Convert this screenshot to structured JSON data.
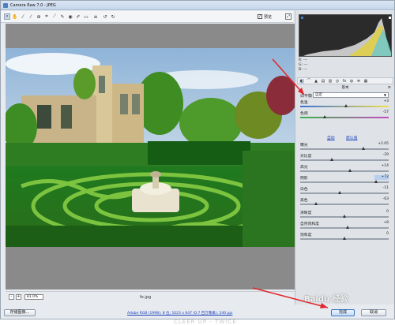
{
  "window": {
    "title": "Camera Raw 7.0 - JPEG"
  },
  "toolbar": {
    "tools": [
      "zoom-icon",
      "hand-icon",
      "white-balance-icon",
      "color-sampler-icon",
      "target-adjust-icon",
      "crop-icon",
      "straighten-icon",
      "spot-removal-icon",
      "red-eye-icon",
      "adjustment-brush-icon",
      "graduated-filter-icon",
      "preferences-icon",
      "rotate-ccw-icon",
      "rotate-cw-icon"
    ],
    "preview_label": "预览",
    "preview_checked": true
  },
  "histogram": {
    "r_label": "R:",
    "g_label": "G:",
    "b_label": "B:",
    "r_value": "---",
    "g_value": "---",
    "b_value": "---"
  },
  "panel": {
    "section_title": "基本",
    "wb_label": "白平衡",
    "wb_value": "自定",
    "auto_link": "自动",
    "default_link": "默认值",
    "sliders": [
      {
        "label": "色温",
        "value": "+3",
        "position": 0.52,
        "highlight": false
      },
      {
        "label": "色调",
        "value": "-57",
        "position": 0.28,
        "highlight": false
      },
      {
        "label": "曝光",
        "value": "+2.05",
        "position": 0.72,
        "highlight": false
      },
      {
        "label": "对比度",
        "value": "-29",
        "position": 0.36,
        "highlight": false
      },
      {
        "label": "高光",
        "value": "+14",
        "position": 0.57,
        "highlight": false
      },
      {
        "label": "阴影",
        "value": "+72",
        "position": 0.86,
        "highlight": true
      },
      {
        "label": "白色",
        "value": "-11",
        "position": 0.45,
        "highlight": false
      },
      {
        "label": "黑色",
        "value": "-63",
        "position": 0.18,
        "highlight": false
      },
      {
        "label": "清晰度",
        "value": "0",
        "position": 0.5,
        "highlight": false
      },
      {
        "label": "自然饱和度",
        "value": "+8",
        "position": 0.54,
        "highlight": false
      },
      {
        "label": "饱和度",
        "value": "0",
        "position": 0.5,
        "highlight": false
      }
    ]
  },
  "bottom_bar": {
    "zoom_value": "81.0%",
    "zoom_out": "-",
    "zoom_in": "+",
    "filename": "fe.jpg"
  },
  "footer": {
    "save_label": "存储图像...",
    "workflow_link": "Adobe RGB (1998); 8 位; 1023 x 647 (0.7 百万像素); 240 ppi",
    "open_label": "完成",
    "cancel_label": "取消"
  },
  "watermark": "Baidu 经验",
  "bottom_caption": "CLEER UP - TWICE",
  "colors": {
    "accent": "#3b77c6",
    "annotation_arrow": "#e0262a"
  }
}
